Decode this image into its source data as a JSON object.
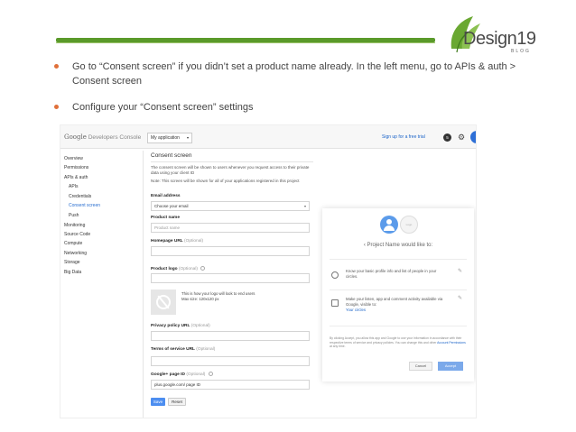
{
  "slide": {
    "bullets": [
      "Go to “Consent screen” if you didn’t set a product name already. In the left menu, go to APIs & auth > Consent screen",
      "Configure your “Consent screen” settings"
    ],
    "logo": {
      "text": "Design19",
      "sub": "BLOG"
    },
    "colors": {
      "rule": "#5a9a2a",
      "bullet": "#e0703a"
    }
  },
  "console": {
    "brand": {
      "google": "Google",
      "product": "Developers Console"
    },
    "project_select": "My application",
    "signup_link": "Sign up for a free trial",
    "notification_count": "5",
    "nav": [
      "Overview",
      "Permissions",
      "APIs & auth",
      "APIs",
      "Credentials",
      "Consent screen",
      "Push",
      "Monitoring",
      "Source Code",
      "Compute",
      "Networking",
      "Storage",
      "Big Data"
    ],
    "form": {
      "title": "Consent screen",
      "description": "The consent screen will be shown to users whenever you request access to their private data using your client ID",
      "note": "Note: This screen will be shown for all of your applications registered in this project",
      "email_label": "Email address",
      "email_value": "Choose your email",
      "product_label": "Product name",
      "product_placeholder": "Product name",
      "homepage_label": "Homepage URL",
      "optional": "(Optional)",
      "logo_label": "Product logo",
      "logo_note_1": "This is how your logo will look to end users",
      "logo_note_2": "Max size: 120x120 px",
      "privacy_label": "Privacy policy URL",
      "terms_label": "Terms of service URL",
      "gplus_label": "Google+ page ID",
      "gplus_value": "plus.google.com/ page ID",
      "save": "Save",
      "reset": "Reset"
    },
    "preview": {
      "logo_text": "Logo",
      "title": "‹ Project Name would like to:",
      "perm1": "Know your basic profile info and list of people in your circles.",
      "perm2": "Make your listen, app and comment activity available via Google, visible to:",
      "perm2_link": "Your circles",
      "fine_print": "By clicking Accept, you allow this app and Google to use your information in accordance with their respective terms of service and privacy policies. You can change this and other",
      "fine_link": "Account Permissions",
      "fine_end": "at any time.",
      "cancel": "Cancel",
      "accept": "Accept"
    }
  }
}
